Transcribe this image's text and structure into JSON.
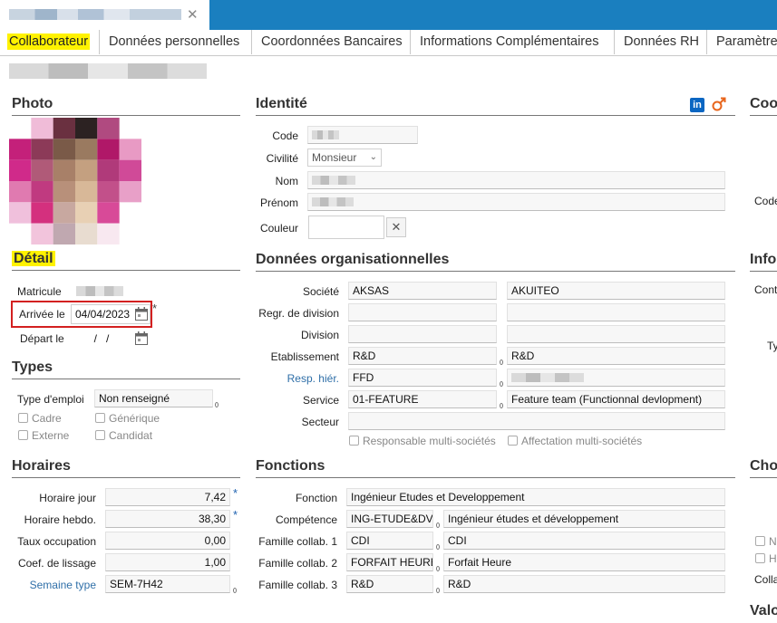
{
  "window": {
    "close_glyph": "✕"
  },
  "tabs": [
    "Collaborateur",
    "Données personnelles",
    "Coordonnées Bancaires",
    "Informations Complémentaires",
    "Données RH",
    "Paramètres"
  ],
  "sections": {
    "photo": "Photo",
    "identite": "Identité",
    "coo": "Coo",
    "detail": "Détail",
    "donnees_org": "Données organisationnelles",
    "info": "Info",
    "types": "Types",
    "horaires": "Horaires",
    "fonctions": "Fonctions",
    "cho": "Cho",
    "val": "Valo"
  },
  "identite": {
    "code_label": "Code",
    "civilite_label": "Civilité",
    "civilite_value": "Monsieur",
    "nom_label": "Nom",
    "prenom_label": "Prénom",
    "couleur_label": "Couleur",
    "clear_glyph": "✕"
  },
  "detail": {
    "matricule_label": "Matricule",
    "arrivee_label": "Arrivée le",
    "arrivee_value": "04/04/2023",
    "depart_label": "Départ le",
    "depart_value": "  /   /",
    "required_mark": "*"
  },
  "types": {
    "type_emploi_label": "Type d'emploi",
    "type_emploi_value": "Non renseigné",
    "checkboxes": [
      "Cadre",
      "Générique",
      "Externe",
      "Candidat"
    ]
  },
  "org": {
    "societe_label": "Société",
    "societe_code": "AKSAS",
    "societe_name": "AKUITEO",
    "regr_label": "Regr. de division",
    "division_label": "Division",
    "etab_label": "Etablissement",
    "etab_code": "R&D",
    "etab_name": "R&D",
    "resp_label": "Resp. hiér.",
    "resp_code": "FFD",
    "service_label": "Service",
    "service_code": "01-FEATURE",
    "service_name": "Feature team (Functionnal devlopment)",
    "secteur_label": "Secteur",
    "multi1": "Responsable multi-sociétés",
    "multi2": "Affectation multi-sociétés"
  },
  "horaires": {
    "jour_label": "Horaire jour",
    "jour_value": "7,42",
    "hebdo_label": "Horaire hebdo.",
    "hebdo_value": "38,30",
    "taux_label": "Taux occupation",
    "taux_value": "0,00",
    "lissage_label": "Coef. de lissage",
    "lissage_value": "1,00",
    "semaine_label": "Semaine type",
    "semaine_value": "SEM-7H42"
  },
  "fonctions": {
    "fonction_label": "Fonction",
    "fonction_value": "Ingénieur Etudes et Developpement",
    "competence_label": "Compétence",
    "competence_code": "ING-ETUDE&DV",
    "competence_name": "Ingénieur études et développement",
    "fam1_label": "Famille collab. 1",
    "fam1_code": "CDI",
    "fam1_name": "CDI",
    "fam2_label": "Famille collab. 2",
    "fam2_code": "FORFAIT HEURE",
    "fam2_name": "Forfait Heure",
    "fam3_label": "Famille collab. 3",
    "fam3_code": "R&D",
    "fam3_name": "R&D"
  },
  "right_col": {
    "code_label": "Code",
    "cont_label": "Cont",
    "ty_label": "Ty",
    "n_label": "N",
    "h_label": "H",
    "colla_label": "Colla"
  },
  "colors": {
    "accent": "#1a7fbf",
    "highlight": "#fff200",
    "linkedin": "#0a66c2",
    "gender": "#e8651c",
    "annot": "#d32020"
  }
}
